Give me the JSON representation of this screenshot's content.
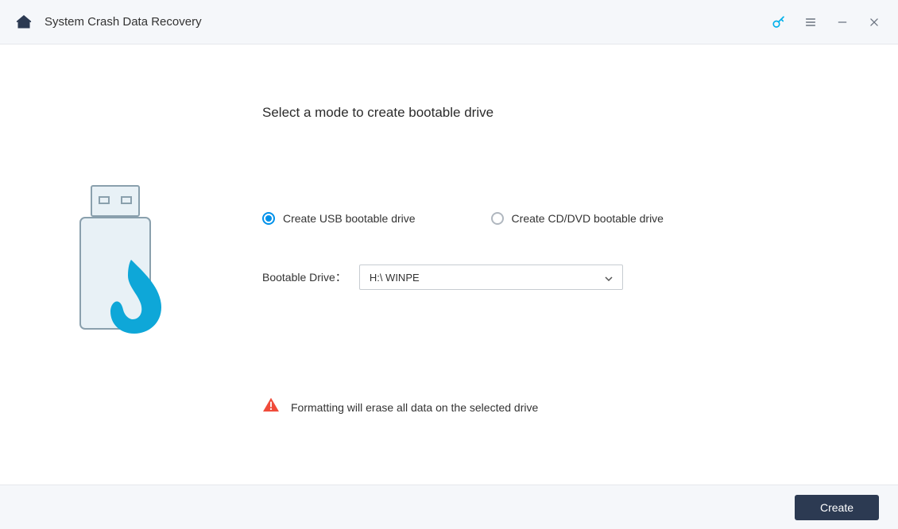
{
  "titlebar": {
    "title": "System Crash Data Recovery"
  },
  "main": {
    "heading": "Select a mode to create bootable drive",
    "options": {
      "usb": "Create USB bootable drive",
      "cd": "Create CD/DVD bootable drive",
      "selected": "usb"
    },
    "drive": {
      "label": "Bootable Drive：",
      "value": "H:\\ WINPE"
    },
    "warning": "Formatting will erase all data on the selected drive"
  },
  "footer": {
    "create_label": "Create"
  }
}
